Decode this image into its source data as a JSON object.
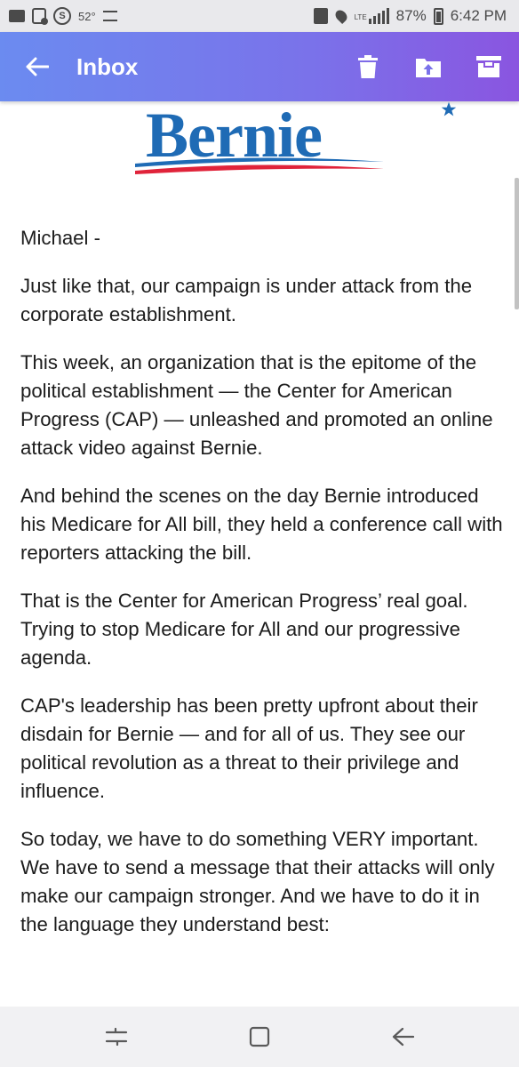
{
  "status_bar": {
    "temperature": "52°",
    "network": "LTE",
    "battery": "87%",
    "time": "6:42 PM",
    "icons": [
      "folder-icon",
      "gallery-icon",
      "s-app-icon",
      "flag-icon",
      "recycle-icon",
      "location-icon",
      "signal-icon",
      "battery-icon"
    ]
  },
  "app_bar": {
    "title": "Inbox",
    "icons": [
      "back-arrow-icon",
      "delete-icon",
      "move-to-icon",
      "archive-icon"
    ],
    "gradient_colors": [
      "#6b8bf0",
      "#8a55e0"
    ]
  },
  "logo": {
    "text": "Bernie",
    "colors": {
      "text": "#1f6bb5",
      "swoosh_red": "#e0233a",
      "swoosh_blue": "#1f6bb5"
    }
  },
  "email": {
    "paragraphs": [
      "Michael -",
      "Just like that, our campaign is under attack from the corporate establishment.",
      "This week, an organization that is the epitome of the political establishment — the Center for American Progress (CAP) — unleashed and promoted an online attack video against Bernie.",
      "And behind the scenes on the day Bernie introduced his Medicare for All bill, they held a conference call with reporters attacking the bill.",
      "That is the Center for American Progress’ real goal. Trying to stop Medicare for All and our progressive agenda.",
      "CAP's leadership has been pretty upfront about their disdain for Bernie — and for all of us. They see our political revolution as a threat to their privilege and influence.",
      "So today, we have to do something VERY important. We have to send a message that their attacks will only make our campaign stronger. And we have to do it in the language they understand best:"
    ]
  },
  "nav_bar": {
    "icons": [
      "recent-apps-icon",
      "home-icon",
      "back-icon"
    ]
  }
}
